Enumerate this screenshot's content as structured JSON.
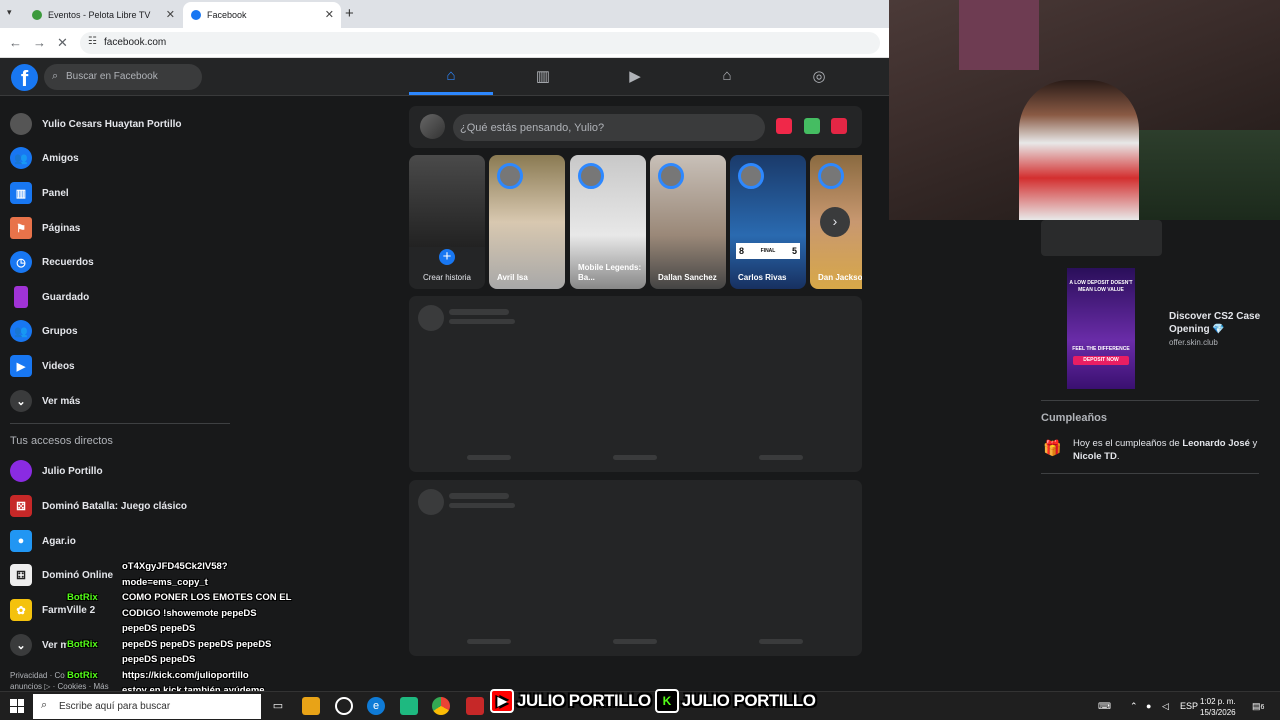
{
  "browser": {
    "tabs": [
      {
        "title": "Eventos - Pelota Libre TV"
      },
      {
        "title": "Facebook"
      }
    ],
    "new_tab": "+",
    "url": "facebook.com"
  },
  "fb": {
    "search_placeholder": "Buscar en Facebook",
    "user_name": "Yulio Cesars Huaytan Portillo",
    "menu": [
      "Amigos",
      "Panel",
      "Páginas",
      "Recuerdos",
      "Guardado",
      "Grupos",
      "Videos",
      "Ver más"
    ],
    "shortcuts_title": "Tus accesos directos",
    "shortcuts": [
      "Julio Portillo",
      "Dominó Batalla: Juego clásico",
      "Agar.io",
      "Dominó Online",
      "FarmVille 2",
      "Ver más"
    ],
    "footer": [
      "Privacidad · Co",
      "anuncios ▷ · Cookies · Más"
    ],
    "composer_placeholder": "¿Qué estás pensando, Yulio?",
    "stories": [
      {
        "name": "Crear historia"
      },
      {
        "name": "Avril Isa"
      },
      {
        "name": "Mobile Legends: Ba..."
      },
      {
        "name": "Dallan Sanchez"
      },
      {
        "name": "Carlos Rivas"
      },
      {
        "name": "Dan Jackso"
      }
    ],
    "score_left": "8",
    "score_label": "FINAL",
    "score_right": "5"
  },
  "right": {
    "ad_image_text": "A LOW DEPOSIT DOESN'T MEAN LOW VALUE",
    "ad_image_text2": "FEEL THE DIFFERENCE",
    "ad_image_cta": "DEPOSIT NOW",
    "ad_title": "Discover CS2 Case Opening 💎",
    "ad_domain": "offer.skin.club",
    "birthdays_title": "Cumpleaños",
    "birthdays_text_prefix": "Hoy es el cumpleaños de ",
    "birthdays_name1": "Leonardo José",
    "birthdays_and": " y ",
    "birthdays_name2": "Nicole TD",
    "birthdays_end": "."
  },
  "stream": {
    "chat_lines": [
      "oT4XgyJFD45Ck2lV58?",
      "mode=ems_copy_t",
      "COMO PONER LOS EMOTES CON EL",
      "CODIGO !showemote pepeDS",
      "pepeDS pepeDS",
      "pepeDS pepeDS pepeDS pepeDS",
      "pepeDS pepeDS",
      "https://kick.com/julioportillo",
      "estoy en kick también ayúdeme"
    ],
    "bot_name": "BotRix",
    "brand1": "JULIO PORTILLO",
    "brand2": "JULIO PORTILLO"
  },
  "taskbar": {
    "search_placeholder": "Escribe aquí para buscar",
    "lang": "ESP",
    "time": "1:02 p. m.",
    "date": "15/3/2026",
    "notif_count": "6"
  }
}
